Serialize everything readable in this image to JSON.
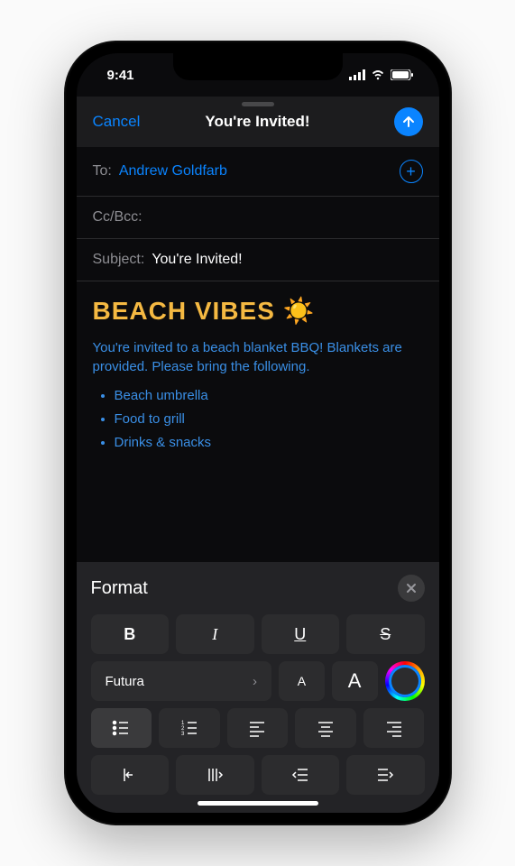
{
  "status": {
    "time": "9:41"
  },
  "nav": {
    "cancel": "Cancel",
    "title": "You're Invited!"
  },
  "to": {
    "label": "To:",
    "value": "Andrew Goldfarb"
  },
  "ccbcc": {
    "label": "Cc/Bcc:"
  },
  "subject": {
    "label": "Subject:",
    "value": "You're Invited!"
  },
  "body": {
    "heading": "BEACH VIBES ☀️",
    "paragraph": "You're invited to a beach blanket BBQ! Blankets are provided. Please bring the following.",
    "bullets": [
      "Beach umbrella",
      "Food to grill",
      "Drinks & snacks"
    ]
  },
  "format": {
    "title": "Format",
    "bold": "B",
    "italic": "I",
    "underline": "U",
    "strike": "S",
    "font_name": "Futura",
    "size_smaller": "A",
    "size_bigger": "A"
  }
}
